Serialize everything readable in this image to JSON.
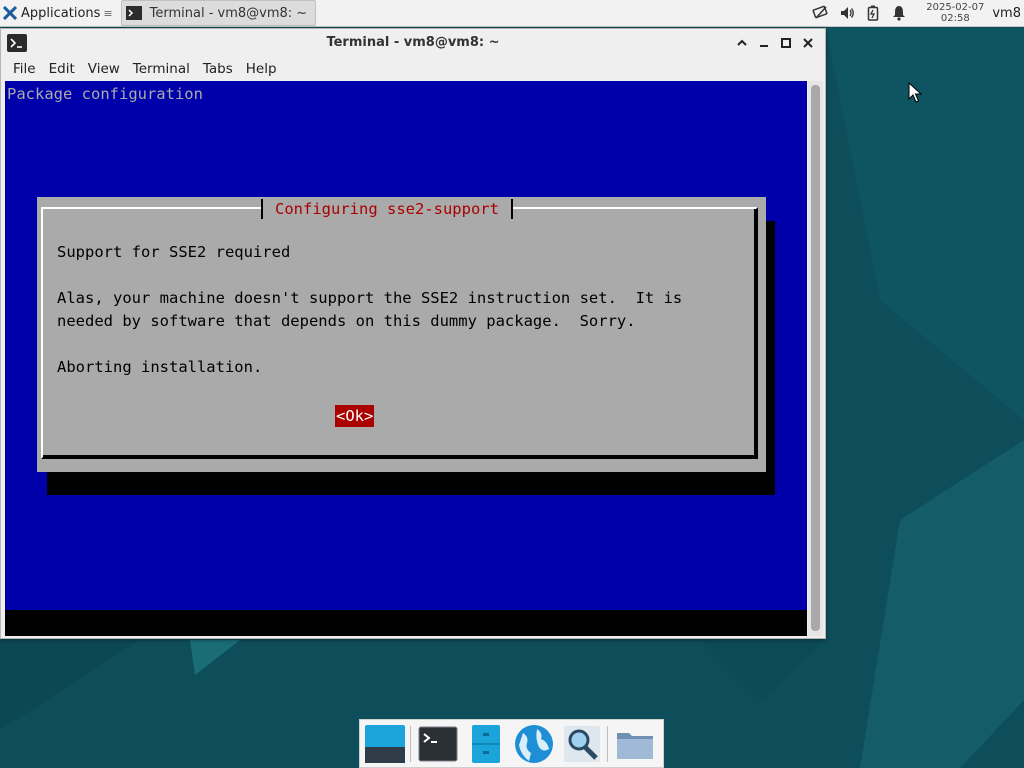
{
  "top_panel": {
    "applications_label": "Applications",
    "task_title": "Terminal - vm8@vm8: ~",
    "clock_date": "2025-02-07",
    "clock_time": "02:58",
    "user": "vm8"
  },
  "window": {
    "title": "Terminal - vm8@vm8: ~",
    "menu": [
      "File",
      "Edit",
      "View",
      "Terminal",
      "Tabs",
      "Help"
    ]
  },
  "terminal": {
    "header": "Package configuration",
    "dialog": {
      "title": "Configuring sse2-support",
      "lines": [
        "Support for SSE2 required",
        "",
        "Alas, your machine doesn't support the SSE2 instruction set.  It is",
        "needed by software that depends on this dummy package.  Sorry.",
        "",
        "Aborting installation."
      ],
      "ok_label": "<Ok>"
    }
  },
  "dock": {
    "items": [
      "show-desktop-icon",
      "terminal-icon",
      "file-manager-icon",
      "web-browser-icon",
      "app-finder-icon",
      "folder-icon"
    ]
  },
  "colors": {
    "terminal_bg": "#0000aa",
    "dialog_bg": "#aaaaaa",
    "dialog_title": "#aa0000",
    "ok_bg": "#aa0000",
    "desktop_bg": "#0e4d5a"
  }
}
